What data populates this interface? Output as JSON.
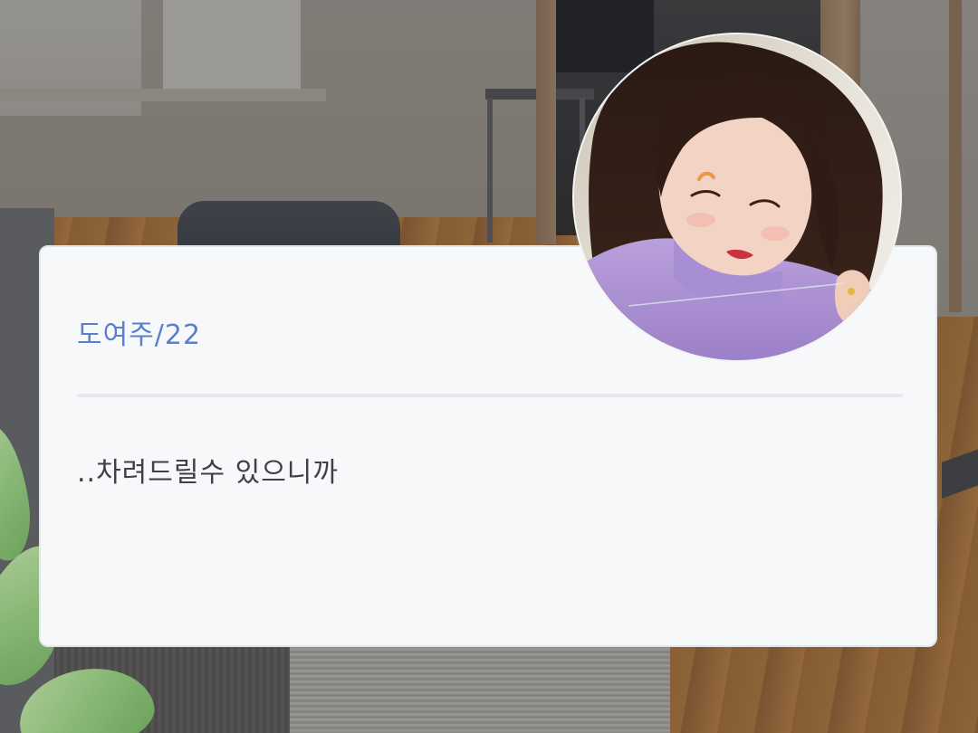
{
  "character": {
    "name_age": "도여주/22"
  },
  "dialogue": {
    "text": "..차려드릴수 있으니까"
  },
  "avatar": {
    "icon": "character-portrait"
  },
  "colors": {
    "name": "#5b7fcf",
    "text": "#3f4144",
    "card_bg": "#f7f8fa"
  }
}
